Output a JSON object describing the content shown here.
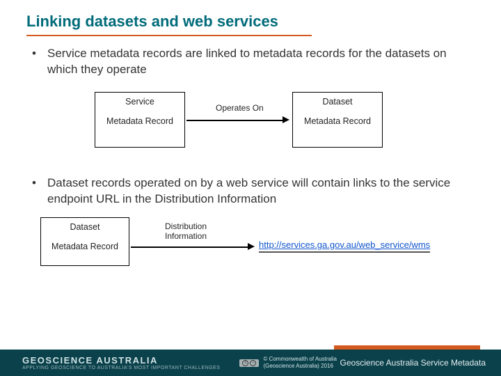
{
  "title": "Linking datasets and web services",
  "bullets": [
    "Service metadata records are linked to metadata records for the datasets on which they operate",
    "Dataset records operated on by a web service will contain links to the service endpoint URL in the Distribution Information"
  ],
  "diagram1": {
    "left_box_top": "Service",
    "left_box_bottom": "Metadata Record",
    "arrow_label": "Operates On",
    "right_box_top": "Dataset",
    "right_box_bottom": "Metadata Record"
  },
  "diagram2": {
    "left_box_top": "Dataset",
    "left_box_bottom": "Metadata Record",
    "arrow_label": "Distribution Information",
    "link_url": "http://services.ga.gov.au/web_service/wms"
  },
  "footer": {
    "brand_main": "GEOSCIENCE AUSTRALIA",
    "brand_sub": "APPLYING GEOSCIENCE TO AUSTRALIA'S MOST IMPORTANT CHALLENGES",
    "cc_label": "cc",
    "copyright_line1": "© Commonwealth of Australia",
    "copyright_line2": "(Geoscience Australia) 2016",
    "right_text": "Geoscience Australia Service Metadata"
  }
}
